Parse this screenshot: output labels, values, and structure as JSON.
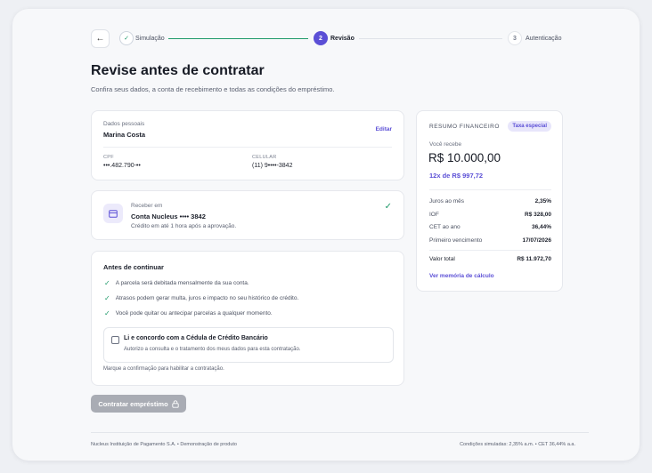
{
  "stepper": {
    "back_icon": "arrow-left-icon",
    "steps": [
      {
        "number": "✓",
        "label": "Simulação",
        "state": "done"
      },
      {
        "number": "2",
        "label": "Revisão",
        "state": "active"
      },
      {
        "number": "3",
        "label": "Autenticação",
        "state": "todo"
      }
    ]
  },
  "page": {
    "title": "Revise antes de contratar",
    "subtitle": "Confira seus dados, a conta de recebimento e todas as condições do empréstimo."
  },
  "personal": {
    "section_label": "Dados pessoais",
    "name": "Marina Costa",
    "edit_label": "Editar",
    "cpf_label": "CPF",
    "cpf_value": "•••.482.790-••",
    "phone_label": "CELULAR",
    "phone_value": "(11) 9••••-3842"
  },
  "account": {
    "label": "Receber em",
    "name": "Conta Nucleus •••• 3842",
    "note": "Crédito em até 1 hora após a aprovação."
  },
  "terms": {
    "title": "Antes de continuar",
    "items": [
      "A parcela será debitada mensalmente da sua conta.",
      "Atrasos podem gerar multa, juros e impacto no seu histórico de crédito.",
      "Você pode quitar ou antecipar parcelas a qualquer momento."
    ],
    "agree_title": "Li e concordo com a Cédula de Crédito Bancário",
    "agree_sub": "Autorizo a consulta e o tratamento dos meus dados para esta contratação.",
    "hint": "Marque a confirmação para habilitar a contratação."
  },
  "cta": {
    "label": "Contratar empréstimo",
    "icon": "lock-icon"
  },
  "summary": {
    "title": "RESUMO FINANCEIRO",
    "badge": "Taxa especial",
    "receive_label": "Você recebe",
    "receive_value": "R$ 10.000,00",
    "installments": "12x de R$ 997,72",
    "rows": [
      {
        "label": "Juros ao mês",
        "value": "2,35%"
      },
      {
        "label": "IOF",
        "value": "R$ 328,00"
      },
      {
        "label": "CET ao ano",
        "value": "36,44%"
      },
      {
        "label": "Primeiro vencimento",
        "value": "17/07/2026"
      }
    ],
    "total_label": "Valor total",
    "total_value": "R$ 11.972,70",
    "memo_link": "Ver memória de cálculo"
  },
  "footer": {
    "left": "Nucleus Instituição de Pagamento S.A. • Demonstração de produto",
    "right": "Condições simuladas: 2,35% a.m. • CET 36,44% a.a."
  },
  "colors": {
    "accent": "#5b4fd6",
    "success": "#1f9a6a",
    "disabled": "#a9acb4"
  }
}
